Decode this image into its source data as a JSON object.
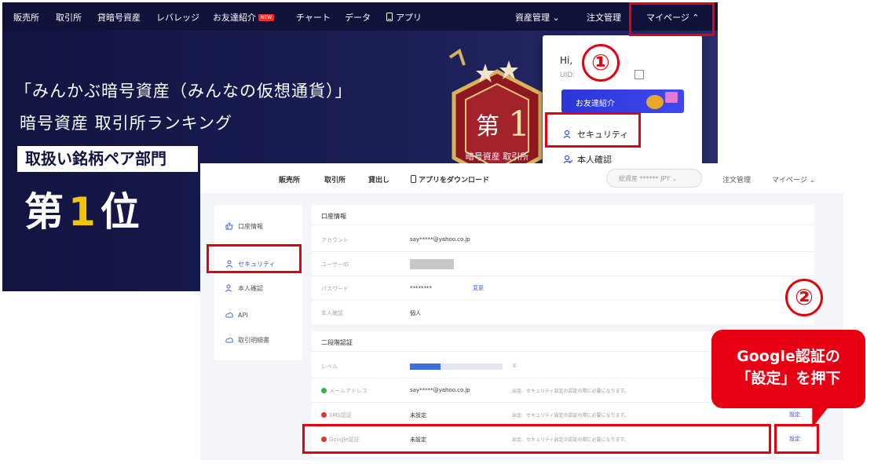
{
  "top_screenshot": {
    "nav": [
      {
        "label": "販売所"
      },
      {
        "label": "取引所"
      },
      {
        "label": "貸暗号資産"
      },
      {
        "label": "レバレッジ"
      },
      {
        "label": "お友達紹介",
        "badge": "NEW"
      },
      {
        "label": "チャート"
      },
      {
        "label": "データ"
      },
      {
        "label": "アプリ",
        "icon": "phone-icon"
      }
    ],
    "nav_right": {
      "asset_management": "資産管理",
      "order_management": "注文管理",
      "my_page": "マイページ"
    },
    "banner": {
      "title": "「みんかぶ暗号資産（みんなの仮想通貨）」",
      "subtitle": "暗号資産 取引所ランキング",
      "category": "取扱い銘柄ペア部門",
      "rank_prefix": "第",
      "rank_number": "1",
      "rank_suffix": "位",
      "trophy_char": "第",
      "trophy_num": "1",
      "trophy_caption": "暗号資産 取引所"
    },
    "dropdown": {
      "greeting": "Hi,",
      "uid_label": "UID:",
      "invite_button": "お友達紹介",
      "security": "セキュリティ",
      "identity": "本人確認"
    }
  },
  "bottom_screenshot": {
    "nav": [
      {
        "label": "販売所"
      },
      {
        "label": "取引所"
      },
      {
        "label": "貸出し"
      },
      {
        "label": "アプリをダウンロード",
        "icon": "phone-icon"
      }
    ],
    "balance_pill": "総資産 ****** JPY",
    "nav_right": {
      "order_management": "注文管理",
      "my_page": "マイページ"
    },
    "sidebar": [
      {
        "label": "口座情報",
        "icon": "thumbs-up-icon"
      },
      {
        "label": "セキュリティ",
        "icon": "person-icon",
        "active": true
      },
      {
        "label": "本人確認",
        "icon": "person-check-icon"
      },
      {
        "label": "API",
        "icon": "cloud-icon"
      },
      {
        "label": "取引明細書",
        "icon": "cloud-icon"
      }
    ],
    "account_info": {
      "heading": "口座情報",
      "rows": [
        {
          "label": "アカウント",
          "value": "say*****@yahoo.co.jp"
        },
        {
          "label": "ユーザーID",
          "value": ""
        },
        {
          "label": "パスワード",
          "value": "********",
          "action": "変更"
        },
        {
          "label": "本人確認",
          "value": "個人"
        }
      ]
    },
    "two_factor": {
      "heading": "二段階認証",
      "level_label": "レベル",
      "level_value": "①",
      "level_fraction": 0.33,
      "rows": [
        {
          "label": "メールアドレス",
          "status": "ok",
          "value": "say*****@yahoo.co.jp",
          "note": "出金、セキュリティ設定の認証の際に必要になります。",
          "action": ""
        },
        {
          "label": "SMS認証",
          "status": "warn",
          "value": "未設定",
          "note": "出金、セキュリティ設定の認証の際に必要になります。",
          "action": "設定"
        },
        {
          "label": "Google認証",
          "status": "warn",
          "value": "未設定",
          "note": "出金、セキュリティ設定の認証の際に必要になります。",
          "action": "設定"
        }
      ]
    }
  },
  "annotations": {
    "step1": "①",
    "step2": "②",
    "callout_line1": "Google認証の",
    "callout_line2": "「設定」を押下"
  },
  "colors": {
    "annotation_red": "#e3000f",
    "banner_navy": "#16184a",
    "accent_blue": "#3b5bdb",
    "rank_yellow": "#f5c400"
  }
}
